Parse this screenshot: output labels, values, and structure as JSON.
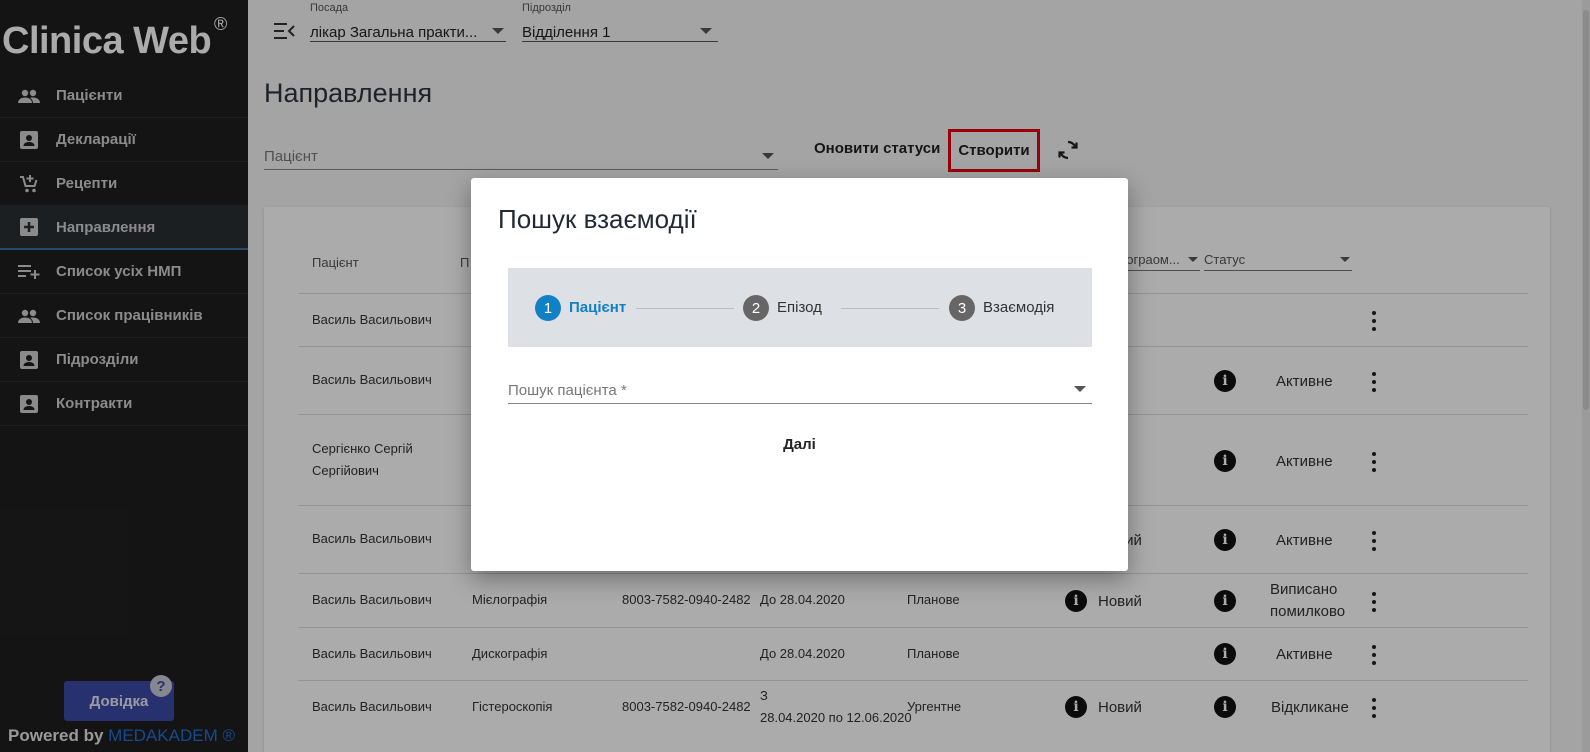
{
  "sidebar": {
    "logo": "Clinica Web",
    "logo_reg": "®",
    "items": [
      {
        "label": "Пацієнти",
        "icon": "people-icon"
      },
      {
        "label": "Декларації",
        "icon": "contact-card-icon"
      },
      {
        "label": "Рецепти",
        "icon": "cart-add-icon"
      },
      {
        "label": "Направлення",
        "icon": "plus-box-icon",
        "active": true
      },
      {
        "label": "Список усіх НМП",
        "icon": "playlist-add-icon"
      },
      {
        "label": "Список працівників",
        "icon": "people-icon"
      },
      {
        "label": "Підрозділи",
        "icon": "contact-card-icon"
      },
      {
        "label": "Контракти",
        "icon": "contact-card-icon"
      }
    ],
    "help_label": "Довідка",
    "help_icon": "?",
    "powered_by": "Powered by",
    "brand": "MEDAKADEM ®"
  },
  "topbar": {
    "position_label": "Посада",
    "position_value": "лікар Загальна практи...",
    "unit_label": "Підрозділ",
    "unit_value": "Відділення 1"
  },
  "page": {
    "title": "Направлення",
    "patient_placeholder": "Пацієнт",
    "update_statuses": "Оновити статуси",
    "create": "Створити"
  },
  "table": {
    "headers": {
      "patient": "Пацієнт",
      "p_col": "П",
      "program": "програом...",
      "status": "Статус"
    },
    "rows": [
      {
        "patient": "Василь Васильович",
        "service": "",
        "number": "",
        "date": "",
        "priority": "",
        "process": "",
        "status": ""
      },
      {
        "patient": "Василь Васильович",
        "service": "",
        "number": "",
        "date": "",
        "priority": "",
        "process": "",
        "status": "Активне"
      },
      {
        "patient": "Сергієнко Сергій",
        "patient2": "Сергійович",
        "service": "",
        "number": "",
        "date": "",
        "priority": "",
        "process": "",
        "status": "Активне"
      },
      {
        "patient": "Василь Васильович",
        "service": "",
        "number": "",
        "date": "",
        "priority": "",
        "process": "Новий",
        "status": "Активне"
      },
      {
        "patient": "Василь Васильович",
        "service": "Мієлографія",
        "number": "8003-7582-0940-2482",
        "date": "До 28.04.2020",
        "priority": "Планове",
        "process": "Новий",
        "status": "Виписано",
        "status2": "помилково"
      },
      {
        "patient": "Василь Васильович",
        "service": "Дискографія",
        "number": "",
        "date": "До 28.04.2020",
        "priority": "Планове",
        "process": "",
        "status": "Активне"
      },
      {
        "patient": "Василь Васильович",
        "service": "Гістероскопія",
        "number": "8003-7582-0940-2482",
        "date": "З",
        "date2": "28.04.2020 по 12.06.2020",
        "priority": "Ургентне",
        "process": "Новий",
        "status": "Відкликане"
      }
    ]
  },
  "modal": {
    "title": "Пошук взаємодії",
    "steps": [
      {
        "num": "1",
        "label": "Пацієнт",
        "active": true
      },
      {
        "num": "2",
        "label": "Епізод",
        "active": false
      },
      {
        "num": "3",
        "label": "Взаємодія",
        "active": false
      }
    ],
    "search_placeholder": "Пошук пацієнта *",
    "next": "Далі"
  },
  "colors": {
    "sidebar_bg": "#1f1f1f",
    "step_active": "#1280c4",
    "step_inactive": "#666666",
    "highlight": "#e3000f",
    "brand": "#1e6fd9"
  }
}
